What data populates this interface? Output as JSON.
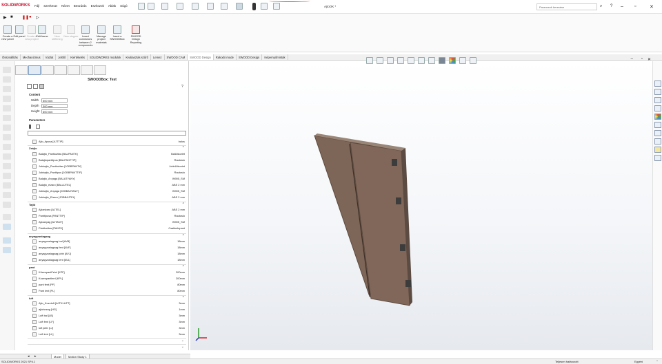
{
  "app": {
    "logo_text": "SOLIDWORKS",
    "document_title": "AjtoOK *",
    "search_placeholder": "Parancsok keresése"
  },
  "menu": [
    "Fájl",
    "Szerkeszt",
    "Nézet",
    "Beszúrás",
    "Eszközök",
    "Ablak",
    "Súgó"
  ],
  "commands": [
    {
      "label": "Create a new panel",
      "enabled": true
    },
    {
      "label": "Edit panel",
      "enabled": true
    },
    {
      "label": "Create a new project",
      "enabled": false
    },
    {
      "label": "Edit frame",
      "enabled": true
    },
    {
      "label": "New stiffening",
      "enabled": false
    },
    {
      "label": "New stopper",
      "enabled": false
    },
    {
      "label": "Insert connectors between 2 components",
      "enabled": true
    },
    {
      "label": "Manage project materials",
      "enabled": true
    },
    {
      "label": "Insert a SWOODBox",
      "enabled": true
    },
    {
      "label": "SWOOD Design Reporting",
      "enabled": true
    }
  ],
  "tabs": [
    "Összeállítás",
    "Mechanizmus",
    "Vázlat",
    "Jelölő",
    "Kiértékelés",
    "SOLIDWORKS modulok",
    "Kiválasztás szűrő",
    "Lemez",
    "SWOOD CAM",
    "SWOOD Design",
    "Rakodó mode",
    "SWOOD Design",
    "Képernyőminták"
  ],
  "active_tab_index": 9,
  "panel": {
    "title": "SWOODBox: Test",
    "content_header": "Content",
    "width_label": "Width",
    "width_value": "500 mm",
    "depth_label": "Depth",
    "depth_value": "300 mm",
    "height_label": "Height",
    "height_value": "600 mm",
    "parameters_header": "Parameters",
    "type_row": {
      "name": "Ajto_tipusa [AJTTIP]",
      "value": "balos"
    },
    "groups": [
      {
        "title": "Zsájlo",
        "rows": [
          {
            "name": "Balajto_Pantkoz̈tas [BALPANTK]",
            "value": "BalUtkoztet"
          },
          {
            "name": "Balajtopanttipus [BALPANTTIP]",
            "value": "Rautoslo"
          },
          {
            "name": "Jobbajto_Pantkoz̈tas [JOBBPANTK]",
            "value": "JobbUtkoztet"
          },
          {
            "name": "Jobbajto_Panttipus [JOBBPANTTIP]",
            "value": "Rautoslo"
          },
          {
            "name": "Balajto_Anyaga [BALATYANY]",
            "value": "W905_SM"
          },
          {
            "name": "Balajto_elzaro [BALAJTEL]",
            "value": "ABS 2 mm"
          },
          {
            "name": "Jobbajto_Anyaga [JOBBAJTANY]",
            "value": "W905_SM"
          },
          {
            "name": "Jobbajto_Elzaro [JOBBAJTEL]",
            "value": "ABS 2 mm"
          }
        ]
      },
      {
        "title": "Tajtö",
        "rows": [
          {
            "name": "Ajtoelzaro [AJTEL]",
            "value": "ABS 2 mm"
          },
          {
            "name": "Panttipusa [PANTTIP]",
            "value": "Rautoslo"
          },
          {
            "name": "Ajtoanyag [AJTANY]",
            "value": "W905_SM"
          },
          {
            "name": "Pántkoz̈tas [PANTK]",
            "value": "Csakkelepant"
          }
        ]
      },
      {
        "title": "anyagvastagsag",
        "rows": [
          {
            "name": "anyagvastagsag bal [AVB]",
            "value": "18mm"
          },
          {
            "name": "anyagvastagsag fent [AVF]",
            "value": "18mm"
          },
          {
            "name": "anyagvastagsag jobb [AVJ]",
            "value": "18mm"
          },
          {
            "name": "anyagvastagsag lent [AVL]",
            "value": "18mm"
          }
        ]
      },
      {
        "title": "pant",
        "rows": [
          {
            "name": "KözespantFelul [KPF]",
            "value": "200mm"
          },
          {
            "name": "Kozespantlent [KPL]",
            "value": "200mm"
          },
          {
            "name": "pant fent [PF]",
            "value": "80mm"
          },
          {
            "name": "Pant lent [PL]",
            "value": "80mm"
          }
        ]
      },
      {
        "title": "luft",
        "rows": [
          {
            "name": "Ajto_Kozeluft [AJTKLUFT]",
            "value": "3mm"
          },
          {
            "name": "ajtohezag [HG]",
            "value": "1mm"
          },
          {
            "name": "Luft bal [LB]",
            "value": "3mm"
          },
          {
            "name": "Luft fent [LF]",
            "value": "3mm"
          },
          {
            "name": "luft jobb [LJ]",
            "value": "3mm"
          },
          {
            "name": "Luft lent [LL]",
            "value": "3mm"
          }
        ]
      }
    ]
  },
  "bottom_tabs": [
    "Model",
    "Motion Study 1"
  ],
  "status": {
    "left": "SOLIDWORKS 2021 SP4.1",
    "center": "Teljesen határozott",
    "right": "Egyéni"
  }
}
